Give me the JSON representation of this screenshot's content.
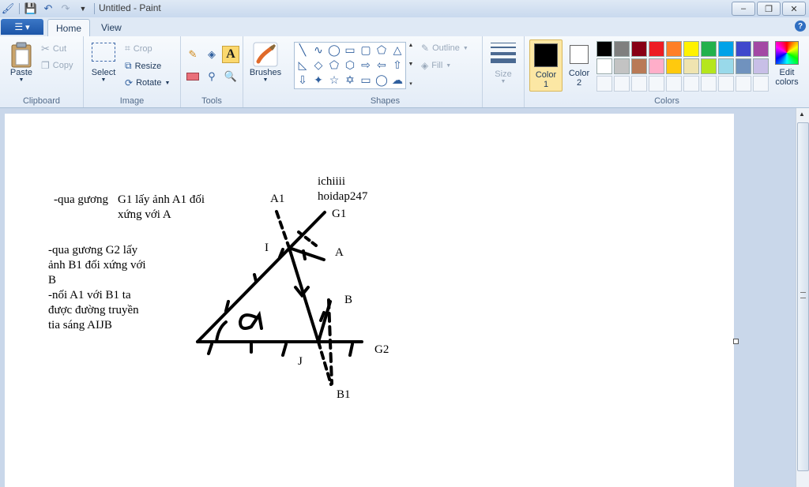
{
  "window": {
    "title": "Untitled - Paint",
    "minimize": "–",
    "maximize": "❐",
    "close": "✕"
  },
  "tabs": {
    "file": "▾",
    "home": "Home",
    "view": "View",
    "help": "?"
  },
  "clipboard": {
    "paste": "Paste",
    "cut": "Cut",
    "copy": "Copy",
    "label": "Clipboard"
  },
  "image": {
    "select": "Select",
    "crop": "Crop",
    "resize": "Resize",
    "rotate": "Rotate",
    "label": "Image"
  },
  "tools": {
    "label": "Tools",
    "text_tool": "A"
  },
  "brushes": {
    "label": "Brushes"
  },
  "shapes": {
    "outline": "Outline",
    "fill": "Fill",
    "label": "Shapes"
  },
  "size": {
    "label": "Size"
  },
  "colors": {
    "color1": "Color",
    "color1_num": "1",
    "color2": "Color",
    "color2_num": "2",
    "edit1": "Edit",
    "edit2": "colors",
    "label": "Colors",
    "color1_value": "#000000",
    "color2_value": "#ffffff",
    "palette_row1": [
      "#000000",
      "#7f7f7f",
      "#880015",
      "#ed1c24",
      "#ff7f27",
      "#fff200",
      "#22b14c",
      "#00a2e8",
      "#3f48cc",
      "#a349a4"
    ],
    "palette_row2": [
      "#ffffff",
      "#c3c3c3",
      "#b97a57",
      "#ffaec9",
      "#ffc90e",
      "#efe4b0",
      "#b5e61d",
      "#99d9ea",
      "#7092be",
      "#c8bfe7"
    ]
  },
  "canvas_text": {
    "line1a": "-qua gương",
    "line1b": "G1 lấy ảnh A1 đối",
    "line1c": "xứng với A",
    "line2a": "-qua gương G2 lấy",
    "line2b": "ảnh B1 đối xứng với",
    "line2c": "B",
    "line3a": "-nối A1 với B1 ta",
    "line3b": "được đường truyền",
    "line3c": "tia sáng AIJB",
    "watermark1": "ichiiii",
    "watermark2": "hoidap247",
    "label_a1": "A1",
    "label_g1": "G1",
    "label_i": "I",
    "label_a": "A",
    "label_b": "B",
    "label_g2": "G2",
    "label_j": "J",
    "label_b1": "B1"
  }
}
